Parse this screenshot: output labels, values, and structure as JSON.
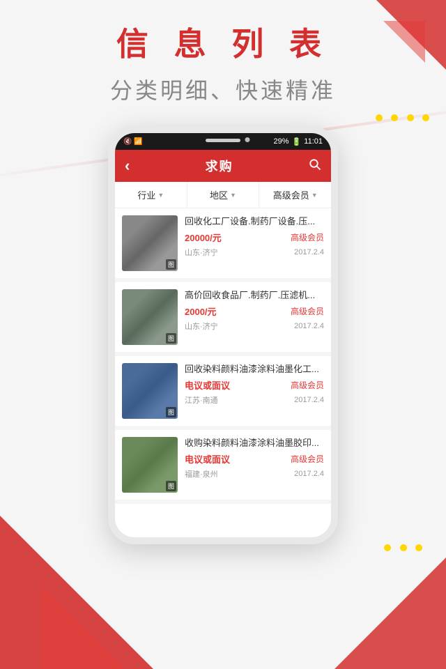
{
  "page": {
    "title": "信 息 列 表",
    "subtitle": "分类明细、快速精准"
  },
  "phone": {
    "status_bar": {
      "left": "",
      "icons": "🔇 📶 29%",
      "time": "11:01"
    },
    "header": {
      "back_icon": "‹",
      "title": "求购",
      "search_icon": "⌕"
    },
    "filters": [
      {
        "label": "行业",
        "arrow": "▼"
      },
      {
        "label": "地区",
        "arrow": "▼"
      },
      {
        "label": "高级会员",
        "arrow": "▼"
      }
    ],
    "list_items": [
      {
        "title": "回收化工厂设备.制药厂设备.压...",
        "price": "20000/元",
        "badge": "高级会员",
        "location": "山东·济宁",
        "date": "2017.2.4",
        "img_class": "img-industrial-1"
      },
      {
        "title": "高价回收食品厂.制药厂.压滤机...",
        "price": "2000/元",
        "badge": "高级会员",
        "location": "山东·济宁",
        "date": "2017.2.4",
        "img_class": "img-industrial-2"
      },
      {
        "title": "回收染料颜料油漆涂料油墨化工...",
        "price": "电议或面议",
        "badge": "高级会员",
        "location": "江苏·南通",
        "date": "2017.2.4",
        "img_class": "img-industrial-3"
      },
      {
        "title": "收购染料颜料油漆涂料油墨胶印...",
        "price": "电议或面议",
        "badge": "高级会员",
        "location": "福建·泉州",
        "date": "2017.2.4",
        "img_class": "img-industrial-4"
      }
    ]
  },
  "icons": {
    "back": "‹",
    "search": "🔍",
    "image_label": "图"
  }
}
